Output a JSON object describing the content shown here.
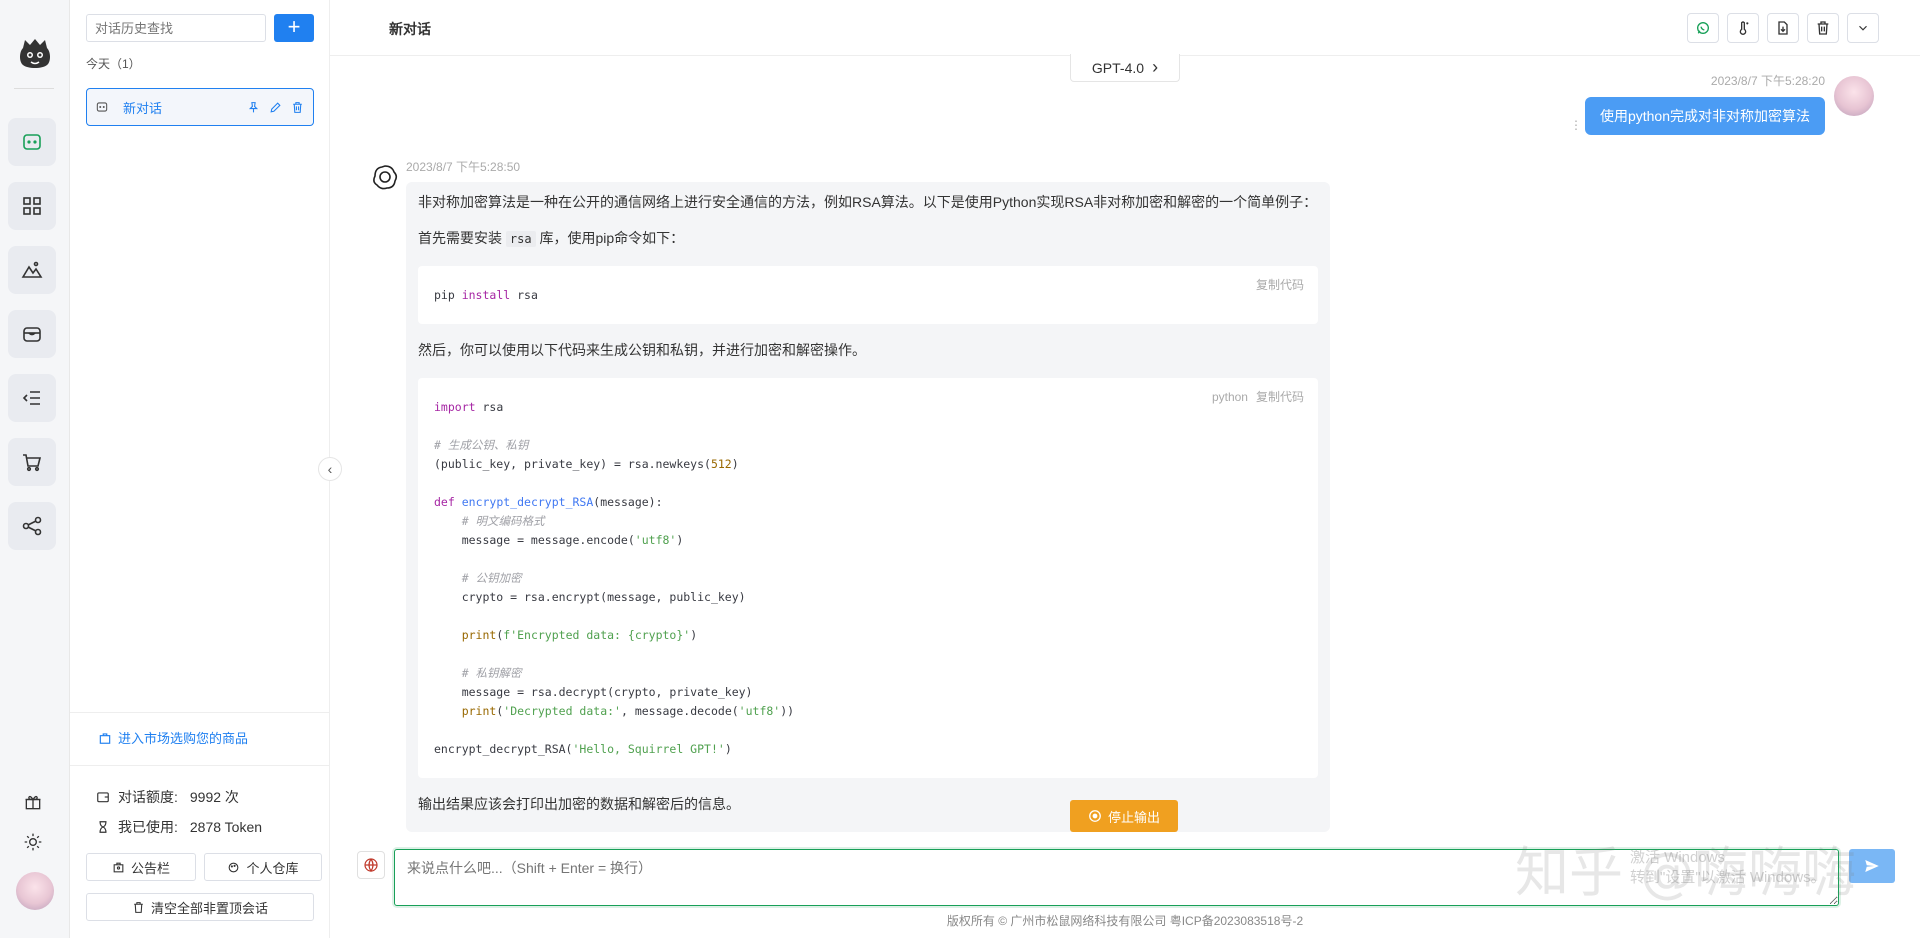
{
  "header": {
    "title": "新对话"
  },
  "sidebar": {
    "search_placeholder": "对话历史查找",
    "add_label": "+",
    "today_label": "今天（1）",
    "conversations": [
      {
        "label": "新对话"
      }
    ],
    "market_link": "进入市场选购您的商品",
    "quota": {
      "label": "对话额度:",
      "value": "9992 次"
    },
    "used": {
      "label": "我已使用:",
      "value": "2878 Token"
    },
    "notice_button": "公告栏",
    "warehouse_button": "个人仓库",
    "clear_button": "清空全部非置顶会话"
  },
  "model": {
    "label": "GPT-4.0"
  },
  "user_message": {
    "time": "2023/8/7 下午5:28:20",
    "text": "使用python完成对非对称加密算法"
  },
  "bot_message": {
    "time": "2023/8/7 下午5:28:50",
    "intro": "非对称加密算法是一种在公开的通信网络上进行安全通信的方法，例如RSA算法。以下是使用Python实现RSA非对称加密和解密的一个简单例子：",
    "install_before": "首先需要安装 ",
    "install_code": "rsa",
    "install_after": " 库，使用pip命令如下：",
    "copy_label": "复制代码",
    "lang_label": "python",
    "then_text": "然后，你可以使用以下代码来生成公钥和私钥，并进行加密和解密操作。",
    "result_text": "输出结果应该会打印出加密的数据和解密后的信息。"
  },
  "stop_button": "停止输出",
  "input": {
    "placeholder": "来说点什么吧...（Shift + Enter = 换行）"
  },
  "footer": "版权所有 © 广州市松鼠网络科技有限公司   粤ICP备2023083518号-2",
  "watermark": {
    "main": "知乎 @嗨嗨嗨",
    "line1": "激活 Windows",
    "line2": "转到\"设置\"以激活 Windows。"
  },
  "colors": {
    "accent": "#2080f0",
    "green": "#18a058",
    "orange": "#f0a020",
    "user_bubble": "#4b9cf4"
  },
  "icons": [
    "chat-icon",
    "apps-icon",
    "image-icon",
    "wallet-icon",
    "list-icon",
    "cart-icon",
    "share-icon",
    "gift-icon",
    "sun-icon",
    "pin-icon",
    "edit-icon",
    "delete-icon",
    "whatsapp-icon",
    "thermometer-icon",
    "download-icon",
    "trash-icon",
    "chevron-down-icon",
    "chevron-left-icon",
    "chevron-right-icon",
    "stop-icon",
    "send-icon",
    "globe-icon",
    "bag-icon",
    "hourglass-icon",
    "wallet-small-icon"
  ]
}
